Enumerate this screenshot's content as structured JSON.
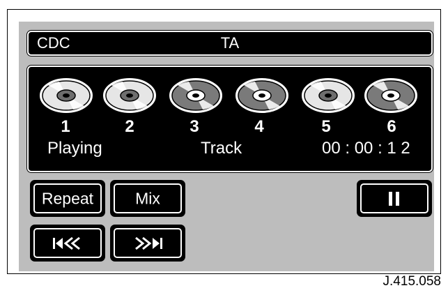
{
  "header": {
    "left_label": "CDC",
    "center_label": "TA"
  },
  "discs": [
    {
      "number": "1",
      "state": "light"
    },
    {
      "number": "2",
      "state": "light"
    },
    {
      "number": "3",
      "state": "dark"
    },
    {
      "number": "4",
      "state": "dark"
    },
    {
      "number": "5",
      "state": "light"
    },
    {
      "number": "6",
      "state": "dark"
    }
  ],
  "status": {
    "playing": "Playing",
    "track": "Track",
    "time": "00 : 00 : 1 2"
  },
  "buttons": {
    "repeat": "Repeat",
    "mix": "Mix",
    "pause_icon": "pause-icon",
    "prev_icon": "skip-back-icon",
    "next_icon": "skip-forward-icon"
  },
  "figure_code": "J.415.058",
  "colors": {
    "screen": "#bdbdbd",
    "panel": "#000000",
    "disc_light": "#e6e6e6",
    "disc_dark": "#7a7a7a"
  }
}
